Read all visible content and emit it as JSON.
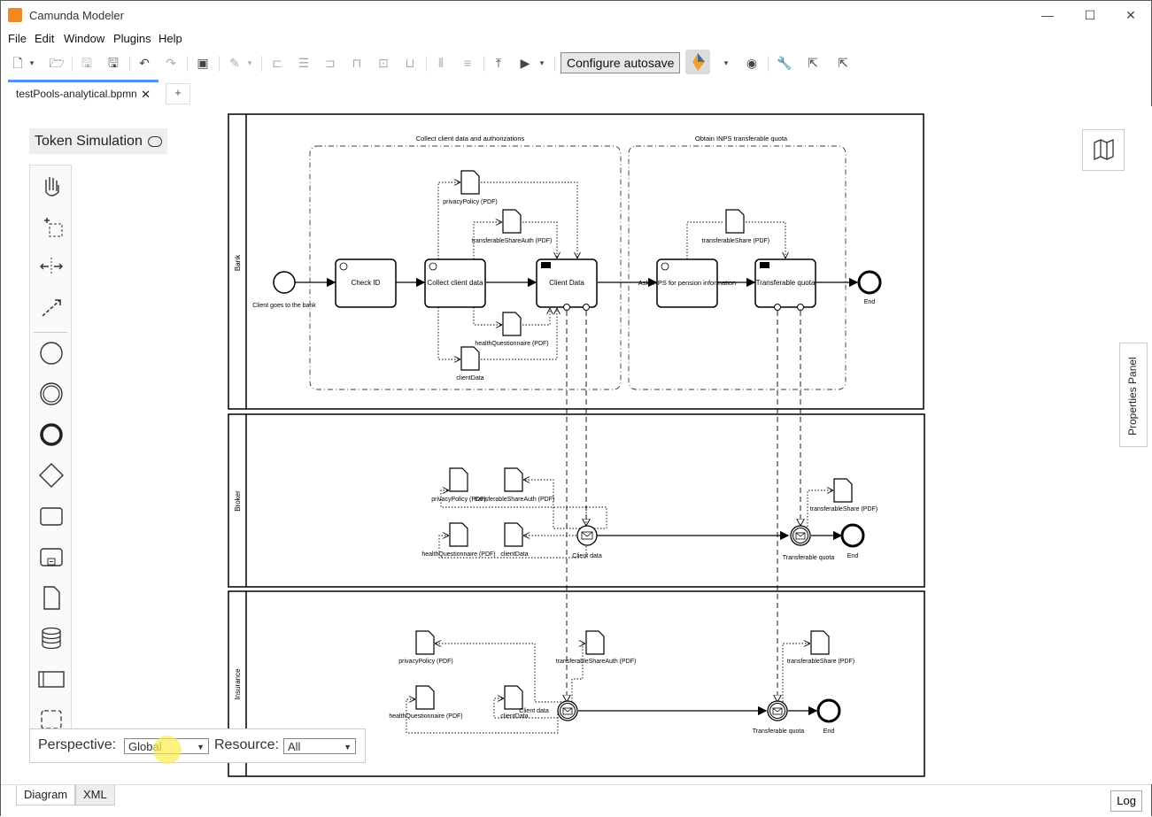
{
  "window": {
    "title": "Camunda Modeler"
  },
  "menu": [
    "File",
    "Edit",
    "Window",
    "Plugins",
    "Help"
  ],
  "toolbar": {
    "autosave_label": "Configure autosave"
  },
  "tabs": [
    {
      "label": "testPools-analytical.bpmn",
      "active": true
    }
  ],
  "token_simulation": {
    "label": "Token Simulation"
  },
  "properties_panel": {
    "label": "Properties Panel"
  },
  "perspective": {
    "label": "Perspective:",
    "value": "Global",
    "resource_label": "Resource:",
    "resource_value": "All"
  },
  "bottom_tabs": [
    "Diagram",
    "XML"
  ],
  "log_label": "Log",
  "diagram": {
    "pools": [
      "Bank",
      "Broker",
      "Insurance"
    ],
    "bank": {
      "start": "Client goes to the bank",
      "group1": "Collect client data and authorizations",
      "group2": "Obtain INPS transferable quota",
      "task_check": "Check ID",
      "task_collect": "Collect client data",
      "task_client_data": "Client Data",
      "task_ask": "Ask INPS for pension information",
      "task_transferable": "Transferable quota",
      "end": "End",
      "doc_privacy": "privacyPolicy (PDF)",
      "doc_transferable": "transferableShareAuth (PDF)",
      "doc_health": "healthQuestionnaire (PDF)",
      "doc_client": "clientData",
      "doc_share": "transferableShare (PDF)"
    },
    "broker": {
      "doc_privacy": "privacyPolicy (PDF)",
      "doc_transferable": "transferableShareAuth (PDF)",
      "doc_health": "healthQuestionnaire (PDF)",
      "doc_client": "clientData",
      "msg_client": "Client data",
      "msg_quota": "Transferable quota",
      "doc_share": "transferableShare (PDF)",
      "end": "End"
    },
    "insurance": {
      "doc_privacy": "privacyPolicy (PDF)",
      "doc_transferable": "transferableShareAuth (PDF)",
      "doc_health": "healthQuestionnaire (PDF)",
      "doc_client": "clientData",
      "msg_client": "Client data",
      "msg_quota": "Transferable quota",
      "doc_share": "transferableShare (PDF)",
      "end": "End"
    }
  }
}
